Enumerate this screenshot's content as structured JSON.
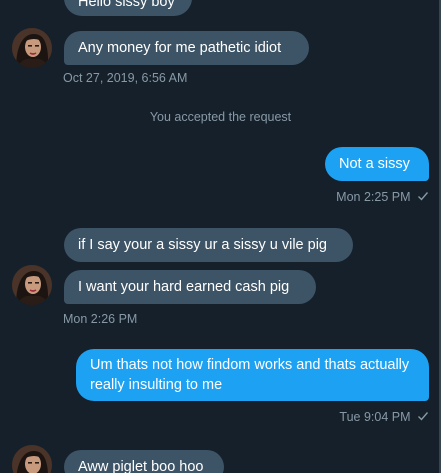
{
  "messages": [
    {
      "text": "Hello sissy boy",
      "direction": "in"
    },
    {
      "text": "Any money for me pathetic idiot",
      "direction": "in"
    },
    {
      "text": "Not a sissy",
      "direction": "out"
    },
    {
      "text": "if I say your a sissy ur a sissy u vile pig",
      "direction": "in"
    },
    {
      "text": "I want your hard earned cash pig",
      "direction": "in"
    },
    {
      "text": "Um thats not how findom works and thats actually really insulting to me",
      "direction": "out"
    },
    {
      "text": "Aww piglet boo hoo",
      "direction": "in"
    }
  ],
  "timestamps": {
    "first": "Oct 27, 2019, 6:56 AM",
    "second": "Mon 2:25 PM",
    "third": "Mon 2:26 PM",
    "fourth": "Tue 9:04 PM"
  },
  "system_message": "You accepted the request",
  "colors": {
    "background": "#15202b",
    "incoming_bubble": "#3d5466",
    "outgoing_bubble": "#1da1f2",
    "meta_text": "#8899a6"
  },
  "icons": {
    "read_receipt": "checkmark-icon",
    "avatar": "user-avatar"
  }
}
